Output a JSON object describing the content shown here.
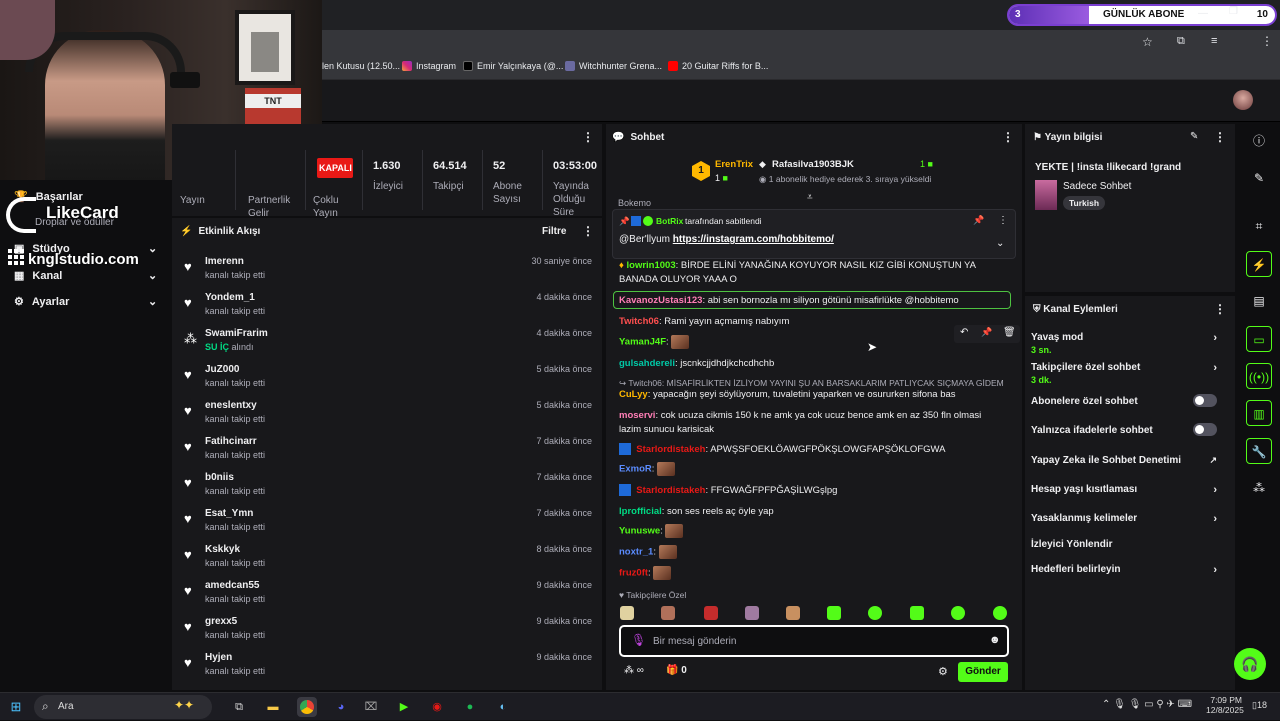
{
  "browser": {
    "bookmarks": [
      "len Kutusu (12.50...",
      "Instagram",
      "Emir Yalçınkaya (@...",
      "Witchhunter Grena...",
      "20 Guitar Riffs for B..."
    ]
  },
  "sub_goal": {
    "current": "3",
    "label": "GÜNLÜK ABONE",
    "goal": "10",
    "progress": 0.3,
    "color": "#7a3fd1"
  },
  "overlay": {
    "brand1": "LikeCard",
    "brand2": "knglstudio.com",
    "webcam_sign": "TNT"
  },
  "left_nav": {
    "achievements": "Başarılar",
    "drops": "Droplar ve ödüller",
    "studio": "Stüdyo",
    "channel": "Kanal",
    "settings": "Ayarlar"
  },
  "stats": {
    "live_badge": "KAPALI",
    "items": [
      {
        "label": "Yayın",
        "value": ""
      },
      {
        "label": "Partnerlik Gelir",
        "value": ""
      },
      {
        "label": "Çoklu Yayın",
        "value": ""
      },
      {
        "label": "İzleyici",
        "value": "1.630"
      },
      {
        "label": "Takipçi",
        "value": "64.514"
      },
      {
        "label": "Abone Sayısı",
        "value": "52"
      },
      {
        "label": "Yayında Olduğu Süre",
        "value": "03:53:00"
      }
    ]
  },
  "activity": {
    "title": "Etkinlik Akışı",
    "filter": "Filtre",
    "items": [
      {
        "name": "Imerenn",
        "sub": "kanalı takip etti",
        "time": "30 saniye önce",
        "icon": "heart-icon"
      },
      {
        "name": "Yondem_1",
        "sub": "kanalı takip etti",
        "time": "4 dakika önce",
        "icon": "heart-icon"
      },
      {
        "name": "SwamiFrarim",
        "sub_hl": "SU İÇ",
        "sub": "alındı",
        "time": "4 dakika önce",
        "icon": "reward-icon"
      },
      {
        "name": "JuZ000",
        "sub": "kanalı takip etti",
        "time": "5 dakika önce",
        "icon": "heart-icon"
      },
      {
        "name": "eneslentxy",
        "sub": "kanalı takip etti",
        "time": "5 dakika önce",
        "icon": "heart-icon"
      },
      {
        "name": "Fatihcinarr",
        "sub": "kanalı takip etti",
        "time": "7 dakika önce",
        "icon": "heart-icon"
      },
      {
        "name": "b0niis",
        "sub": "kanalı takip etti",
        "time": "7 dakika önce",
        "icon": "heart-icon"
      },
      {
        "name": "Esat_Ymn",
        "sub": "kanalı takip etti",
        "time": "7 dakika önce",
        "icon": "heart-icon"
      },
      {
        "name": "Kskkyk",
        "sub": "kanalı takip etti",
        "time": "8 dakika önce",
        "icon": "heart-icon"
      },
      {
        "name": "amedcan55",
        "sub": "kanalı takip etti",
        "time": "9 dakika önce",
        "icon": "heart-icon"
      },
      {
        "name": "grexx5",
        "sub": "kanalı takip etti",
        "time": "9 dakika önce",
        "icon": "heart-icon"
      },
      {
        "name": "Hyjen",
        "sub": "kanalı takip etti",
        "time": "9 dakika önce",
        "icon": "heart-icon"
      }
    ]
  },
  "chat": {
    "title": "Sohbet",
    "leader1_name": "ErenTrix",
    "leader1_count": "1",
    "leader2_name": "Rafasilva1903BJK",
    "leader2_count": "1",
    "leader2_sub": "1 abonelik hediye ederek 3. sıraya yükseldi",
    "rank_badge": "1",
    "cut_line": "Bokemo",
    "pinned_by": "BotRix",
    "pinned_label": "tarafından sabitlendi",
    "pinned_user": "@Ber'llyum",
    "pinned_link": "https://instagram.com/hobbitemo/",
    "messages": [
      {
        "user": "lowrin1003",
        "color": "#53fc18",
        "text": "BİRDE ELİNİ YANAĞINA KOYUYOR NASIL KIZ GİBİ KONUŞTUN YA BANADA OLUYOR YAAA O"
      },
      {
        "user": "KavanozUstasi123",
        "color": "#ff7eb6",
        "text": "abi sen bornozla mı siliyon götünü misafirlükte @hobbitemo"
      },
      {
        "user": "Twitch06",
        "color": "#ff4f4f",
        "text": "Rami yayın açmamış nabıyım"
      },
      {
        "user": "YamanJ4F",
        "color": "#53fc18",
        "text": ""
      },
      {
        "user": "gulsahdereli",
        "color": "#00c9a7",
        "text": "jscnkcjjdhdjkchcdhchb"
      },
      {
        "user": "Twitch06",
        "color": "#adadb8",
        "text": "MİSAFİRLİKTEN İZLİYOM YAYINI ŞU AN BARSAKLARIM PATLIYCAK SIÇMAYA GİDEMİ..."
      },
      {
        "user": "CuLyy",
        "color": "#ffb800",
        "text": "yapacağın şeyi söylüyorum, tuvaletini yaparken ve osururken sifona bas"
      },
      {
        "user": "moservi",
        "color": "#ff7eb6",
        "text": "cok ucuza cikmis 150 k ne amk ya cok ucuz bence amk en az 350 fln olmasi lazim sunucu karisicak"
      },
      {
        "user": "Starlordistakeh",
        "color": "#e91916",
        "text": "APWŞSFOEKLÖAWGFPÖKŞLOWGFAPŞÖKLOFGWA"
      },
      {
        "user": "ExmoR",
        "color": "#5b8cff",
        "text": ""
      },
      {
        "user": "Starlordistakeh",
        "color": "#e91916",
        "text": "FFGWAĞFPFPĞAŞİLWGşlpg"
      },
      {
        "user": "lprofficial",
        "color": "#00db84",
        "text": "son ses reels aç öyle yap"
      },
      {
        "user": "Yunuswe",
        "color": "#53fc18",
        "text": ""
      },
      {
        "user": "noxtr_1",
        "color": "#5b8cff",
        "text": ""
      },
      {
        "user": "fruz0ft",
        "color": "#e91916",
        "text": ""
      }
    ],
    "followers_only": "Takipçilere Özel",
    "input_placeholder": "Bir mesaj gönderin",
    "send": "Gönder",
    "gift_count": "0"
  },
  "stream_info": {
    "title_label": "Yayın bilgisi",
    "stream_title": "YEKTE | !insta !likecard !grand",
    "category": "Sadece Sohbet",
    "tag": "Turkish"
  },
  "channel_actions": {
    "title": "Kanal Eylemleri",
    "rows": [
      {
        "label": "Yavaş mod",
        "sub": "3 sn.",
        "type": "chevron"
      },
      {
        "label": "Takipçilere özel sohbet",
        "sub": "3 dk.",
        "type": "chevron"
      },
      {
        "label": "Abonelere özel sohbet",
        "sub": "",
        "type": "toggle"
      },
      {
        "label": "Yalnızca ifadelerle sohbet",
        "sub": "",
        "type": "toggle"
      },
      {
        "label": "Yapay Zeka ile Sohbet Denetimi",
        "sub": "",
        "type": "external"
      },
      {
        "label": "Hesap yaşı kısıtlaması",
        "sub": "",
        "type": "chevron"
      },
      {
        "label": "Yasaklanmış kelimeler",
        "sub": "",
        "type": "chevron"
      },
      {
        "label": "İzleyici Yönlendir",
        "sub": "",
        "type": "none"
      },
      {
        "label": "Hedefleri belirleyin",
        "sub": "",
        "type": "chevron"
      }
    ]
  },
  "taskbar": {
    "search": "Ara",
    "time": "7:09 PM",
    "date": "12/8/2025",
    "notif": "18"
  },
  "colors": {
    "accent": "#53fc18",
    "bg": "#0e0e10",
    "panel": "#18181b"
  }
}
